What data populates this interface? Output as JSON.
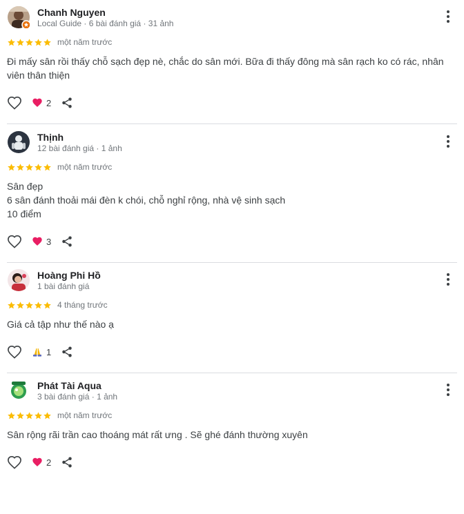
{
  "colors": {
    "star": "#fbbc04",
    "heart": "#e91e63",
    "text": "#3c4043",
    "meta": "#70757a"
  },
  "reviews": [
    {
      "name": "Chanh Nguyen",
      "meta": "Local Guide · 6 bài đánh giá · 31 ảnh",
      "rating": 5,
      "time": "một năm trước",
      "text": "Đi mấy sân rồi thấy chỗ sạch đẹp nè, chắc do sân mới. Bữa đi thấy đông mà sân rạch ko có rác, nhân\nviên thân thiện",
      "reaction_icon": "heart-icon",
      "reaction_count": "2"
    },
    {
      "name": "Thịnh",
      "meta": "12 bài đánh giá · 1 ảnh",
      "rating": 5,
      "time": "một năm trước",
      "text": "Sân đẹp\n6 sân đánh thoải mái đèn k chói, chỗ nghỉ rộng, nhà vệ sinh sạch\n10 điểm",
      "reaction_icon": "heart-icon",
      "reaction_count": "3"
    },
    {
      "name": "Hoàng Phi Hồ",
      "meta": "1 bài đánh giá",
      "rating": 5,
      "time": "4 tháng trước",
      "text": "Giá cả tập như thế nào ạ",
      "reaction_icon": "folded-hands-icon",
      "reaction_count": "1"
    },
    {
      "name": "Phát Tài Aqua",
      "meta": "3 bài đánh giá · 1 ảnh",
      "rating": 5,
      "time": "một năm trước",
      "text": "Sân rộng rãi trần cao thoáng mát rất ưng . Sẽ ghé đánh thường xuyên",
      "reaction_icon": "heart-icon",
      "reaction_count": "2"
    }
  ]
}
